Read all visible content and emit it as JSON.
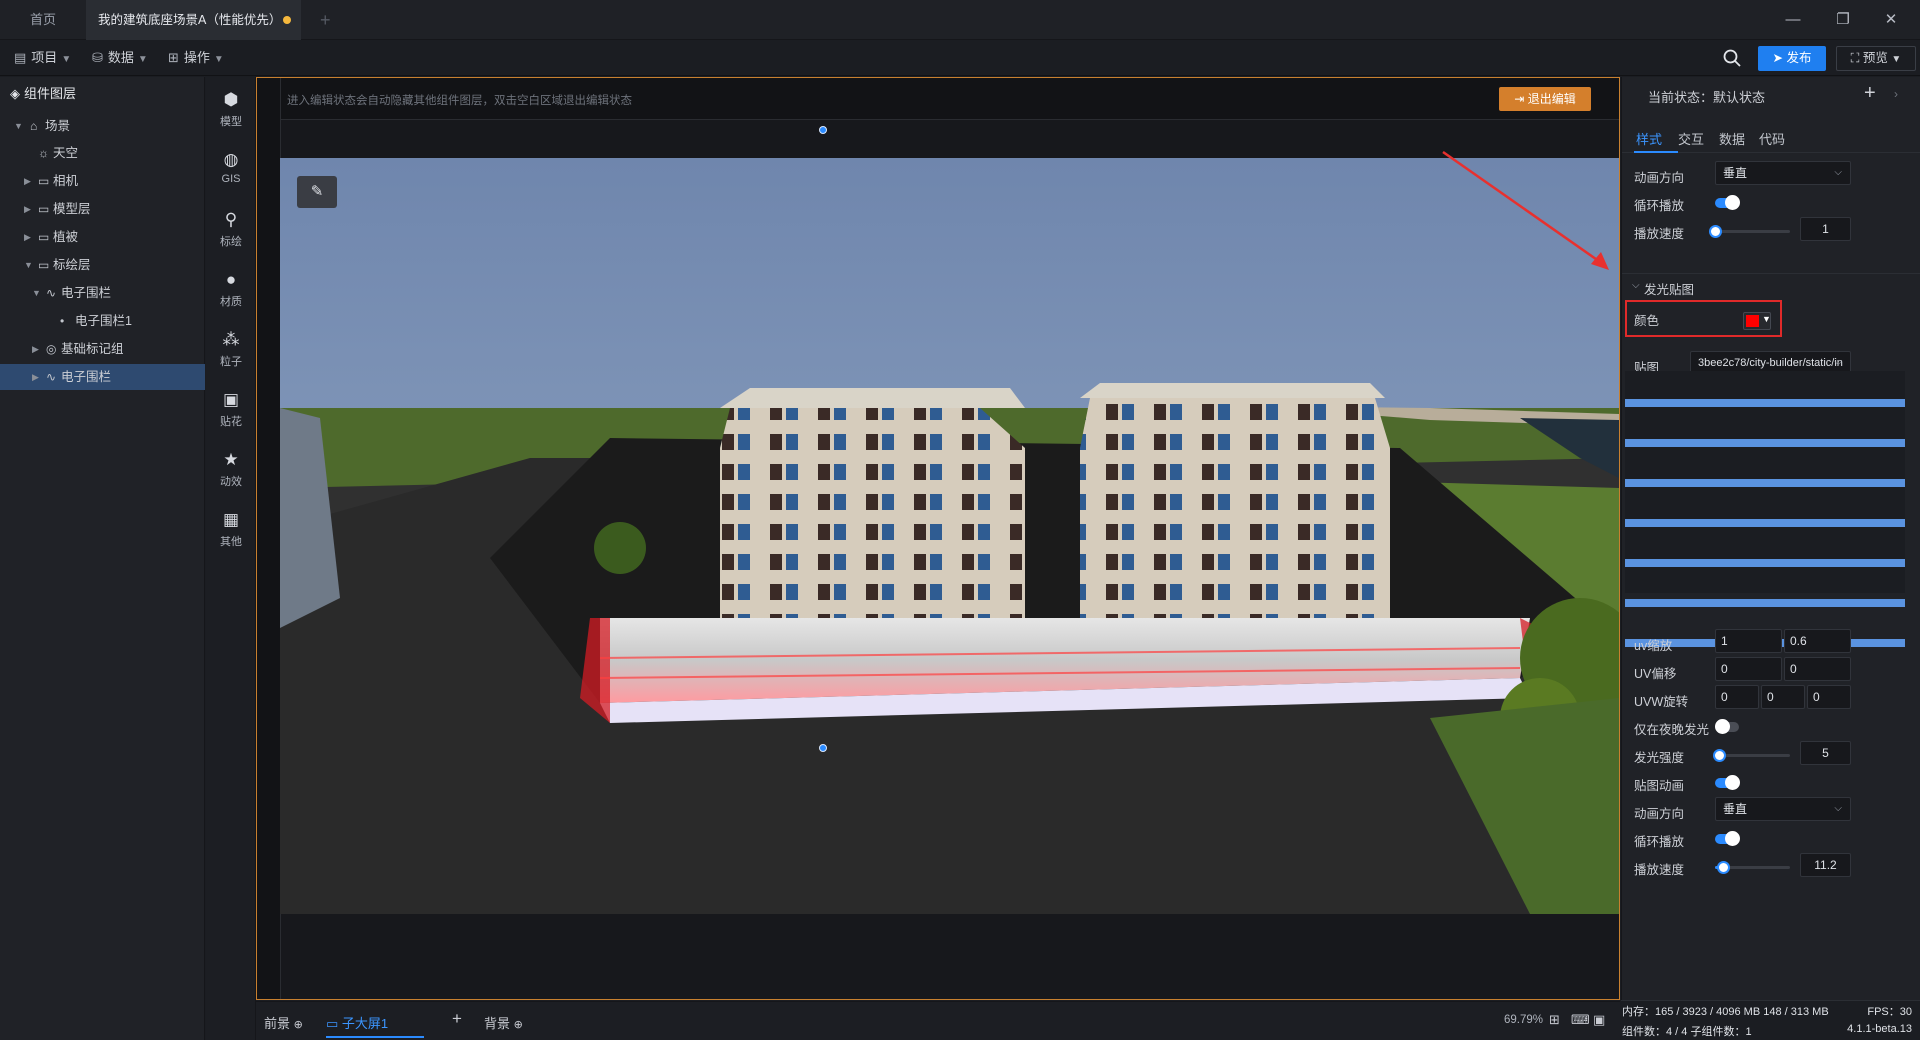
{
  "tabs": {
    "home": "首页",
    "scene": "我的建筑底座场景A（性能优先）"
  },
  "toolbar": {
    "project": "项目",
    "data": "数据",
    "operate": "操作",
    "publish": "发布",
    "preview": "预览"
  },
  "layers": {
    "title": "组件图层",
    "items": [
      {
        "label": "场景"
      },
      {
        "label": "天空"
      },
      {
        "label": "相机"
      },
      {
        "label": "模型层"
      },
      {
        "label": "植被"
      },
      {
        "label": "标绘层"
      },
      {
        "label": "电子围栏"
      },
      {
        "label": "电子围栏1"
      },
      {
        "label": "基础标记组"
      },
      {
        "label": "电子围栏"
      }
    ]
  },
  "components": [
    {
      "label": "模型",
      "icon": "cube-icon"
    },
    {
      "label": "GIS",
      "icon": "globe-icon"
    },
    {
      "label": "标绘",
      "icon": "pin-icon"
    },
    {
      "label": "材质",
      "icon": "sphere-icon"
    },
    {
      "label": "粒子",
      "icon": "particle-icon"
    },
    {
      "label": "贴花",
      "icon": "image-icon"
    },
    {
      "label": "动效",
      "icon": "star-icon"
    },
    {
      "label": "其他",
      "icon": "grid-icon"
    }
  ],
  "canvas": {
    "hint": "进入编辑状态会自动隐藏其他组件图层，双击空白区域退出编辑状态",
    "exit_edit": "退出编辑"
  },
  "bottom": {
    "front": "前景",
    "screen": "子大屏1",
    "back": "背景",
    "zoom": "69.79%"
  },
  "props": {
    "state": "当前状态：默认状态",
    "tabs": [
      "样式",
      "交互",
      "数据",
      "代码"
    ],
    "anim_dir_label": "动画方向",
    "anim_dir_value": "垂直",
    "loop_label": "循环播放",
    "speed_label": "播放速度",
    "speed_value": "1",
    "speed_level": 0,
    "glow_section": "发光贴图",
    "color_label": "颜色",
    "color_value": "#ff0000",
    "texture_label": "贴图",
    "texture_value": "3bee2c78/city-builder/static/in",
    "uv_scale_label": "uv缩放",
    "uv_scale": [
      "1",
      "0.6"
    ],
    "uv_offset_label": "UV偏移",
    "uv_offset": [
      "0",
      "0"
    ],
    "uvw_rot_label": "UVW旋转",
    "uvw_rot": [
      "0",
      "0",
      "0"
    ],
    "night_label": "仅在夜晚发光",
    "glow_strength_label": "发光强度",
    "glow_strength": "5",
    "glow_strength_level": 0.05,
    "tex_anim_label": "贴图动画",
    "anim_dir2_label": "动画方向",
    "anim_dir2_value": "垂直",
    "loop2_label": "循环播放",
    "speed2_label": "播放速度",
    "speed2_value": "11.2",
    "speed2_level": 0.1
  },
  "status": {
    "memory": "内存：165 / 3923 / 4096 MB  148 / 313 MB",
    "fps": "FPS：30",
    "count": "组件数：4 / 4   子组件数：1",
    "version": "4.1.1-beta.13"
  }
}
